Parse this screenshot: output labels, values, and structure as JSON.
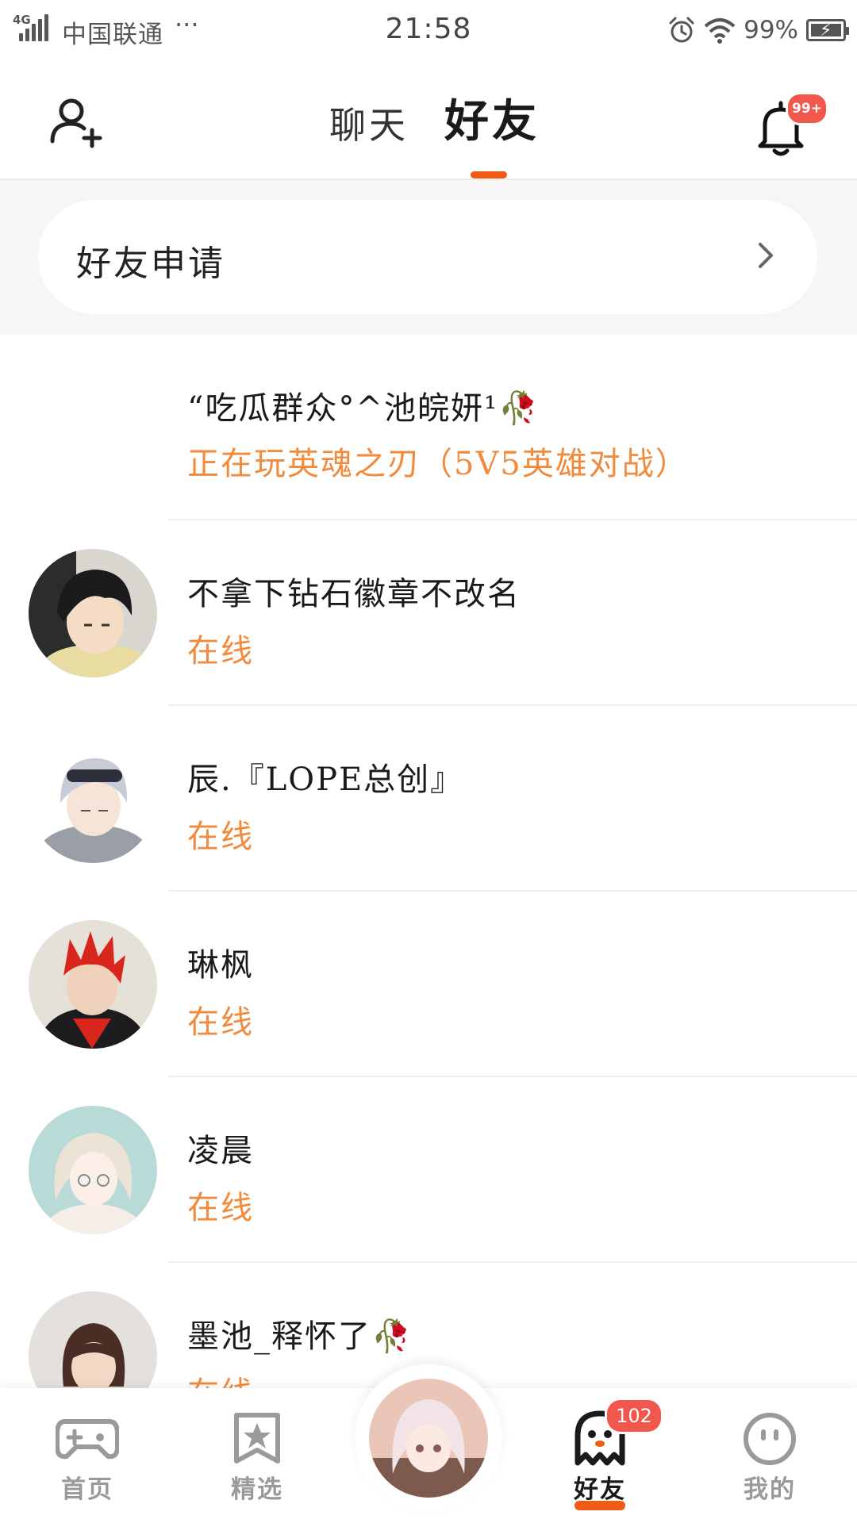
{
  "status_bar": {
    "network": "4G",
    "carrier": "中国联通",
    "more": "···",
    "time": "21:58",
    "battery_percent": "99%",
    "icons": [
      "signal-icon",
      "alarm-icon",
      "wifi-icon",
      "battery-charging-icon"
    ]
  },
  "header": {
    "add_friend_icon": "add-user-icon",
    "tabs": [
      {
        "label": "聊天",
        "active": false
      },
      {
        "label": "好友",
        "active": true
      }
    ],
    "notification_badge": "99+",
    "accent_color": "#f15b14"
  },
  "friend_request": {
    "label": "好友申请"
  },
  "friends": [
    {
      "name": "“吃瓜群众°^池皖妍¹🥀",
      "status": "正在玩英魂之刃（5V5英雄对战）",
      "has_avatar": false
    },
    {
      "name": "不拿下钻石徽章不改名",
      "status": "在线",
      "has_avatar": true
    },
    {
      "name": "辰.『LOPE总创』",
      "status": "在线",
      "has_avatar": true
    },
    {
      "name": "琳枫",
      "status": "在线",
      "has_avatar": true
    },
    {
      "name": "凌晨",
      "status": "在线",
      "has_avatar": true
    },
    {
      "name": "墨池_释怀了🥀",
      "status": "在线",
      "has_avatar": true
    }
  ],
  "status_color": "#f28a3c",
  "bottom_nav": {
    "items": [
      {
        "label": "首页",
        "icon": "gamepad-icon",
        "active": false
      },
      {
        "label": "精选",
        "icon": "bookmark-star-icon",
        "active": false
      },
      {
        "label": "",
        "icon": "profile-avatar",
        "active": false
      },
      {
        "label": "好友",
        "icon": "ghost-icon",
        "active": true,
        "badge": "102"
      },
      {
        "label": "我的",
        "icon": "face-icon",
        "active": false
      }
    ]
  }
}
